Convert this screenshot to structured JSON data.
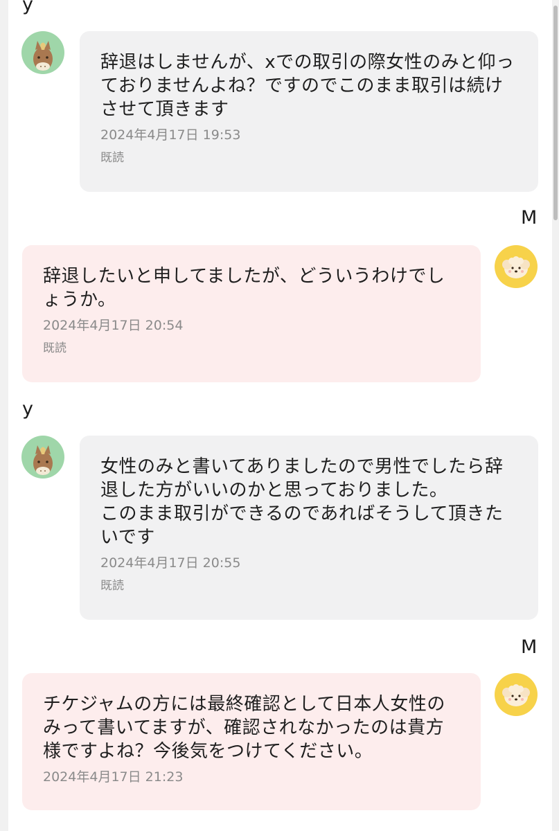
{
  "messages": [
    {
      "sender": "y",
      "direction": "received",
      "avatar": "horse-avatar-icon",
      "text": "辞退はしませんが、xでの取引の際女性のみと仰っておりませんよね？ですのでこのまま取引は続けさせて頂きます",
      "time": "2024年4月17日 19:53",
      "read": "既読"
    },
    {
      "sender": "M",
      "direction": "sent",
      "avatar": "dog-avatar-icon",
      "text": "辞退したいと申してましたが、どういうわけでしょうか。",
      "time": "2024年4月17日 20:54",
      "read": "既読"
    },
    {
      "sender": "y",
      "direction": "received",
      "avatar": "horse-avatar-icon",
      "text": "女性のみと書いてありましたので男性でしたら辞退した方がいいのかと思っておりました。\nこのまま取引ができるのであればそうして頂きたいです",
      "time": "2024年4月17日 20:55",
      "read": "既読"
    },
    {
      "sender": "M",
      "direction": "sent",
      "avatar": "dog-avatar-icon",
      "text": "チケジャムの方には最終確認として日本人女性のみって書いてますが、確認されなかったのは貴方様ですよね？今後気をつけてください。",
      "time": "2024年4月17日 21:23",
      "read": ""
    }
  ],
  "colors": {
    "received_bubble": "#f1f1f2",
    "sent_bubble": "#fdeded",
    "horse_avatar_bg": "#9fd6a9",
    "dog_avatar_bg": "#f7d24a",
    "meta_text": "#8a8a8a"
  }
}
